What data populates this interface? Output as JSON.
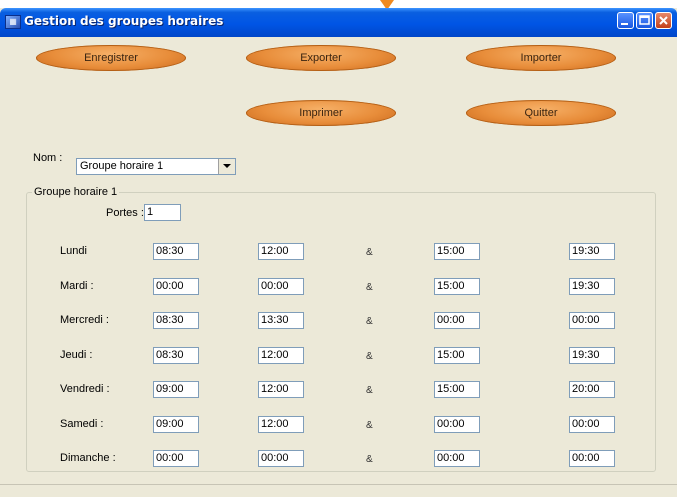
{
  "window": {
    "title": "Gestion des groupes horaires"
  },
  "buttons": {
    "enregistrer": "Enregistrer",
    "exporter": "Exporter",
    "importer": "Importer",
    "imprimer": "Imprimer",
    "quitter": "Quitter"
  },
  "nom": {
    "label": "Nom :",
    "selected": "Groupe horaire 1"
  },
  "group": {
    "title": "Groupe horaire 1",
    "portes_label": "Portes :",
    "portes_value": "1"
  },
  "separator": "&",
  "days": [
    {
      "label": "Lundi",
      "t1": "08:30",
      "t2": "12:00",
      "t3": "15:00",
      "t4": "19:30"
    },
    {
      "label": "Mardi :",
      "t1": "00:00",
      "t2": "00:00",
      "t3": "15:00",
      "t4": "19:30"
    },
    {
      "label": "Mercredi :",
      "t1": "08:30",
      "t2": "13:30",
      "t3": "00:00",
      "t4": "00:00"
    },
    {
      "label": "Jeudi :",
      "t1": "08:30",
      "t2": "12:00",
      "t3": "15:00",
      "t4": "19:30"
    },
    {
      "label": "Vendredi :",
      "t1": "09:00",
      "t2": "12:00",
      "t3": "15:00",
      "t4": "20:00"
    },
    {
      "label": "Samedi :",
      "t1": "09:00",
      "t2": "12:00",
      "t3": "00:00",
      "t4": "00:00"
    },
    {
      "label": "Dimanche :",
      "t1": "00:00",
      "t2": "00:00",
      "t3": "00:00",
      "t4": "00:00"
    }
  ],
  "colors": {
    "accent": "#e88d3a",
    "titlebar": "#0055e5",
    "background": "#ece9d8"
  }
}
